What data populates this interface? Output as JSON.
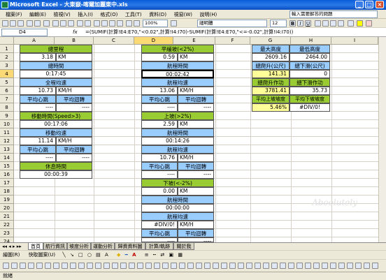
{
  "window": {
    "title": "Microsoft Excel - 大東嶽-喀爾加麗東中.xls"
  },
  "menu": [
    "檔案(F)",
    "編輯(E)",
    "檢視(V)",
    "插入(I)",
    "格式(O)",
    "工具(T)",
    "資料(D)",
    "視窗(W)",
    "說明(H)"
  ],
  "ask_placeholder": "輸入需要解答的問題",
  "toolbar": {
    "zoom": "100%",
    "font": "細明體",
    "size": "12"
  },
  "formula": {
    "cell": "D4",
    "fx": "fx",
    "text": "=(SUMIF(計算!E4:E70,\"<0.02\",計算!I4:I70)-SUMIF(計算!E4:E70,\"<=-0.02\",計算!I4:I70))"
  },
  "columns": [
    "A",
    "B",
    "C",
    "D",
    "E",
    "F",
    "G",
    "H",
    "I"
  ],
  "rows": [
    "1",
    "2",
    "3",
    "4",
    "5",
    "6",
    "7",
    "8",
    "9",
    "10",
    "11",
    "12",
    "13",
    "14",
    "15",
    "16",
    "17",
    "18",
    "19",
    "20",
    "21",
    "22",
    "23",
    "24"
  ],
  "left": {
    "total_dist": "總里程",
    "dist_val": "3.18",
    "dist_unit": "KM",
    "total_time": "總時間",
    "time_val": "0:17:45",
    "avg_speed": "全程均速",
    "speed_val": "10.73",
    "speed_unit": "KM/H",
    "avg_hr": "平均心跳",
    "avg_rpm": "平均迴轉",
    "hr_val": "----",
    "rpm_val": "----",
    "move_time": "移動時間(Speed>3)",
    "move_val": "00:17:06",
    "move_speed": "移動均速",
    "move_speed_val": "11.14",
    "move_speed_unit": "KM/H",
    "avg_hr2": "平均心跳",
    "avg_rpm2": "平均迴轉",
    "hr2_val": "----",
    "rpm2_val": "----",
    "rest_time": "休息時間",
    "rest_val": "00:00:39"
  },
  "mid": {
    "flat_title": "平緩坡(<2%)",
    "flat_dist": "0.59",
    "flat_unit": "KM",
    "flat_time_lbl": "航程時間",
    "flat_time": "00:02:42",
    "flat_speed_lbl": "航程均速",
    "flat_speed": "13.06",
    "flat_speed_unit": "KM/H",
    "flat_hr_lbl": "平均心跳",
    "flat_rpm_lbl": "平均迴轉",
    "flat_hr": "----",
    "flat_rpm": "----",
    "up_title": "上坡(>2%)",
    "up_dist": "2.59",
    "up_unit": "KM",
    "up_time_lbl": "航程時間",
    "up_time": "00:14:26",
    "up_speed_lbl": "航程均速",
    "up_speed": "10.76",
    "up_speed_unit": "KM/H",
    "up_hr_lbl": "平均心跳",
    "up_rpm_lbl": "平均迴轉",
    "up_hr": "----",
    "up_rpm": "----",
    "down_title": "下坡(<-2%)",
    "down_dist": "0.00",
    "down_unit": "KM",
    "down_time_lbl": "航程時間",
    "down_time": "00:00:00",
    "down_speed_lbl": "航程均速",
    "down_speed": "#DIV/0!",
    "down_speed_unit": "KM/H",
    "down_hr_lbl": "平均心跳",
    "down_rpm_lbl": "平均迴轉",
    "down_hr": "----",
    "down_rpm": "----"
  },
  "right": {
    "max_alt": "最大高度",
    "min_alt": "最低高度",
    "max_val": "2609.16",
    "min_val": "2464.00",
    "climb": "總爬升(公尺)",
    "descent": "總下滑(公尺)",
    "climb_val": "141.31",
    "descent_val": "0",
    "climb_work": "總爬升作功",
    "descent_work": "總下滑作功",
    "climb_work_val": "3781.41",
    "descent_work_val": "35.73",
    "avg_up": "平均上坡坡度",
    "avg_down": "平均下坡坡度",
    "avg_up_val": "5.46%",
    "avg_down_val": "#DIV/0!"
  },
  "tabs": [
    "首頁",
    "航行資訊",
    "坡度分析",
    "運動分析",
    "歸資資料圖",
    "計算/軌跡",
    "關於我"
  ],
  "drawbar": {
    "draw": "繪圖(R)",
    "shapes": "快取圖案(U)"
  },
  "status": "就緒",
  "watermark": "Aboolutely"
}
